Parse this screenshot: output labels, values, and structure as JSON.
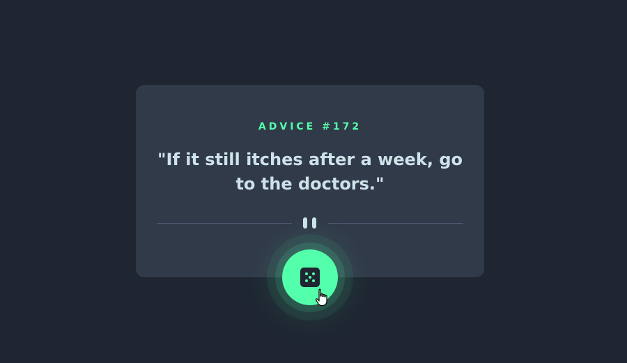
{
  "card": {
    "advice_id_label": "ADVICE #172",
    "advice_text": "\"If it still itches after a week, go to the doctors.\""
  },
  "divider": {
    "icon": "pause-icon"
  },
  "action": {
    "icon": "dice-icon"
  },
  "colors": {
    "background": "#1f2632",
    "card": "#313a49",
    "accent": "#53ffaa",
    "text": "#cee3e9",
    "divider": "#4f5d74"
  },
  "cursor": {
    "icon": "hand-pointer-icon"
  }
}
